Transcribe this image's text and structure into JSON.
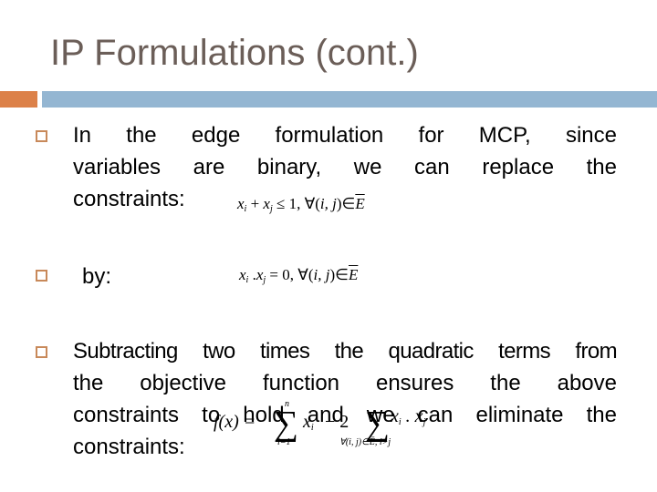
{
  "slide": {
    "title": "IP Formulations (cont.)",
    "accent_colors": {
      "orange": "#dc8149",
      "blue": "#94b6d2",
      "title_text": "#6b5e58",
      "bullet": "#c8895a"
    },
    "bullets": [
      {
        "lines": [
          "In the edge formulation for MCP, since",
          "variables are binary, we can replace the",
          "constraints:"
        ],
        "formula": {
          "lhs": "x_i + x_j ≤ 1",
          "rhs": "∀(i, j) ∈ Ē",
          "text_parts": {
            "x": "x",
            "i": "i",
            "plus": " + ",
            "j": "j",
            "rel": " ≤ 1, ∀(",
            "ij": "i, j",
            "close": ")∈",
            "E": "E"
          }
        }
      },
      {
        "lines": [
          "by:"
        ],
        "formula": {
          "lhs": "x_i . x_j = 0",
          "rhs": "∀(i, j) ∈ Ē",
          "text_parts": {
            "x": "x",
            "i": "i",
            "dot": " .",
            "j": "j",
            "rel": " = 0, ∀(",
            "ij": "i, j",
            "close": ")∈",
            "E": "E"
          }
        }
      },
      {
        "lines": [
          "Subtracting two times the quadratic terms from",
          "the objective function ensures the above",
          "constraints to hold and we can eliminate the",
          "constraints:"
        ],
        "formula": {
          "text": "f(x) = Σ_{i=1}^{n} x_i − 2 Σ_{∀(i,j)∈Ē, i>j} x_i . x_j",
          "parts": {
            "f": "f(x) =",
            "sigma": "∑",
            "n": "n",
            "lower1": "i=1",
            "xi": "x",
            "i": "i",
            "minus2": "− 2",
            "lower2": "∀(i, j)∈Ē, i>j",
            "xixj_x": "x",
            "xixj_dot": " . x"
          }
        }
      }
    ]
  }
}
